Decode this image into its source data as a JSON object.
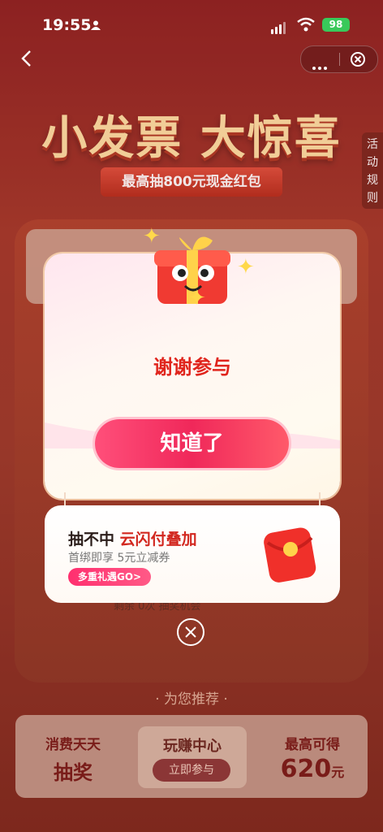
{
  "status_bar": {
    "time": "19:55",
    "battery": "98"
  },
  "background": {
    "title": "小发票 大惊喜",
    "subtitle": "最高抽800元现金红包",
    "rules_label": "活动规则",
    "remaining_text": "剩余 0次 抽奖机会",
    "recommend_title": "· 为您推荐 ·"
  },
  "dialog": {
    "result": "谢谢参与",
    "ok_button": "知道了"
  },
  "promo_card": {
    "title_prefix": "抽不中",
    "title_highlight": "云闪付叠加",
    "subtitle": "首绑即享 5元立减券",
    "badge": "多重礼遇GO>"
  },
  "bottom_cards": {
    "left_line1": "消费天天",
    "left_line2": "抽奖",
    "middle_title": "玩赚中心",
    "middle_button": "立即参与",
    "right_line1": "最高可得",
    "right_amount": "620",
    "right_unit": "元"
  }
}
